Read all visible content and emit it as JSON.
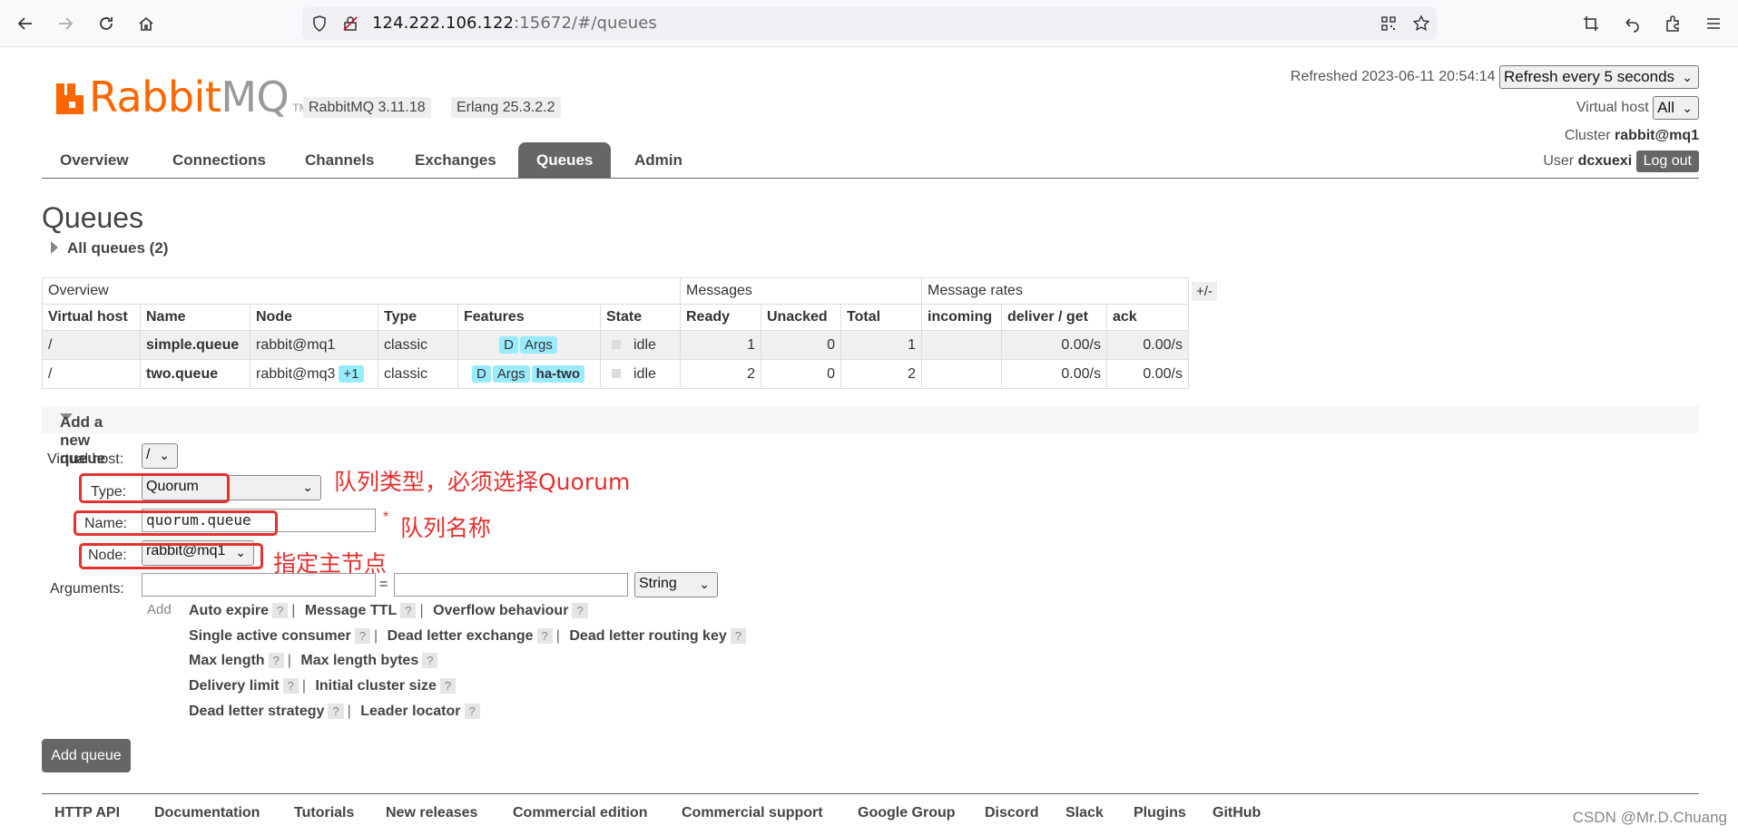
{
  "browser": {
    "url_host": "124.222.106.122",
    "url_rest": ":15672/#/queues"
  },
  "header": {
    "logo_rabbit": "Rabbit",
    "logo_mq": "MQ",
    "logo_tm": "TM",
    "rabbit_version": "RabbitMQ 3.11.18",
    "erlang_version": "Erlang 25.3.2.2",
    "refreshed_label": "Refreshed 2023-06-11 20:54:14",
    "refresh_select": "Refresh every 5 seconds",
    "vhost_label": "Virtual host",
    "vhost_value": "All",
    "cluster_label": "Cluster",
    "cluster_value": "rabbit@mq1",
    "user_label": "User",
    "user_value": "dcxuexi",
    "logout": "Log out"
  },
  "tabs": [
    "Overview",
    "Connections",
    "Channels",
    "Exchanges",
    "Queues",
    "Admin"
  ],
  "page": {
    "title": "Queues",
    "all_queues": "All queues (2)",
    "toggle_columns": "+/-"
  },
  "table": {
    "groups": [
      "Overview",
      "Messages",
      "Message rates"
    ],
    "headers": [
      "Virtual host",
      "Name",
      "Node",
      "Type",
      "Features",
      "State",
      "Ready",
      "Unacked",
      "Total",
      "incoming",
      "deliver / get",
      "ack"
    ],
    "rows": [
      {
        "vhost": "/",
        "name": "simple.queue",
        "node": "rabbit@mq1",
        "node_extra": "",
        "type": "classic",
        "features": [
          "D",
          "Args"
        ],
        "state": "idle",
        "ready": "1",
        "unacked": "0",
        "total": "1",
        "incoming": "",
        "deliver": "0.00/s",
        "ack": "0.00/s"
      },
      {
        "vhost": "/",
        "name": "two.queue",
        "node": "rabbit@mq3",
        "node_extra": "+1",
        "type": "classic",
        "features": [
          "D",
          "Args",
          "ha-two"
        ],
        "state": "idle",
        "ready": "2",
        "unacked": "0",
        "total": "2",
        "incoming": "",
        "deliver": "0.00/s",
        "ack": "0.00/s"
      }
    ]
  },
  "add_queue": {
    "section_title": "Add a new queue",
    "vhost_label": "Virtual host:",
    "vhost_value": "/",
    "type_label": "Type:",
    "type_value": "Quorum",
    "name_label": "Name:",
    "name_value": "quorum.queue",
    "required_star": "*",
    "node_label": "Node:",
    "node_value": "rabbit@mq1",
    "args_label": "Arguments:",
    "args_eq": "=",
    "args_type": "String",
    "add_link": "Add",
    "arg_lines": [
      [
        "Auto expire",
        "Message TTL",
        "Overflow behaviour"
      ],
      [
        "Single active consumer",
        "Dead letter exchange",
        "Dead letter routing key"
      ],
      [
        "Max length",
        "Max length bytes"
      ],
      [
        "Delivery limit",
        "Initial cluster size"
      ],
      [
        "Dead letter strategy",
        "Leader locator"
      ]
    ],
    "help_mark": "?",
    "separator": "|",
    "submit": "Add queue"
  },
  "annotations": {
    "type_note": "队列类型，必须选择Quorum",
    "name_note": "队列名称",
    "node_note": "指定主节点"
  },
  "footer": [
    "HTTP API",
    "Documentation",
    "Tutorials",
    "New releases",
    "Commercial edition",
    "Commercial support",
    "Google Group",
    "Discord",
    "Slack",
    "Plugins",
    "GitHub"
  ],
  "watermark": "CSDN @Mr.D.Chuang",
  "colors": {
    "brand_orange": "#ff6600",
    "tab_active": "#666666",
    "feature_badge": "#99ebff",
    "annotation_red": "#e53030"
  }
}
